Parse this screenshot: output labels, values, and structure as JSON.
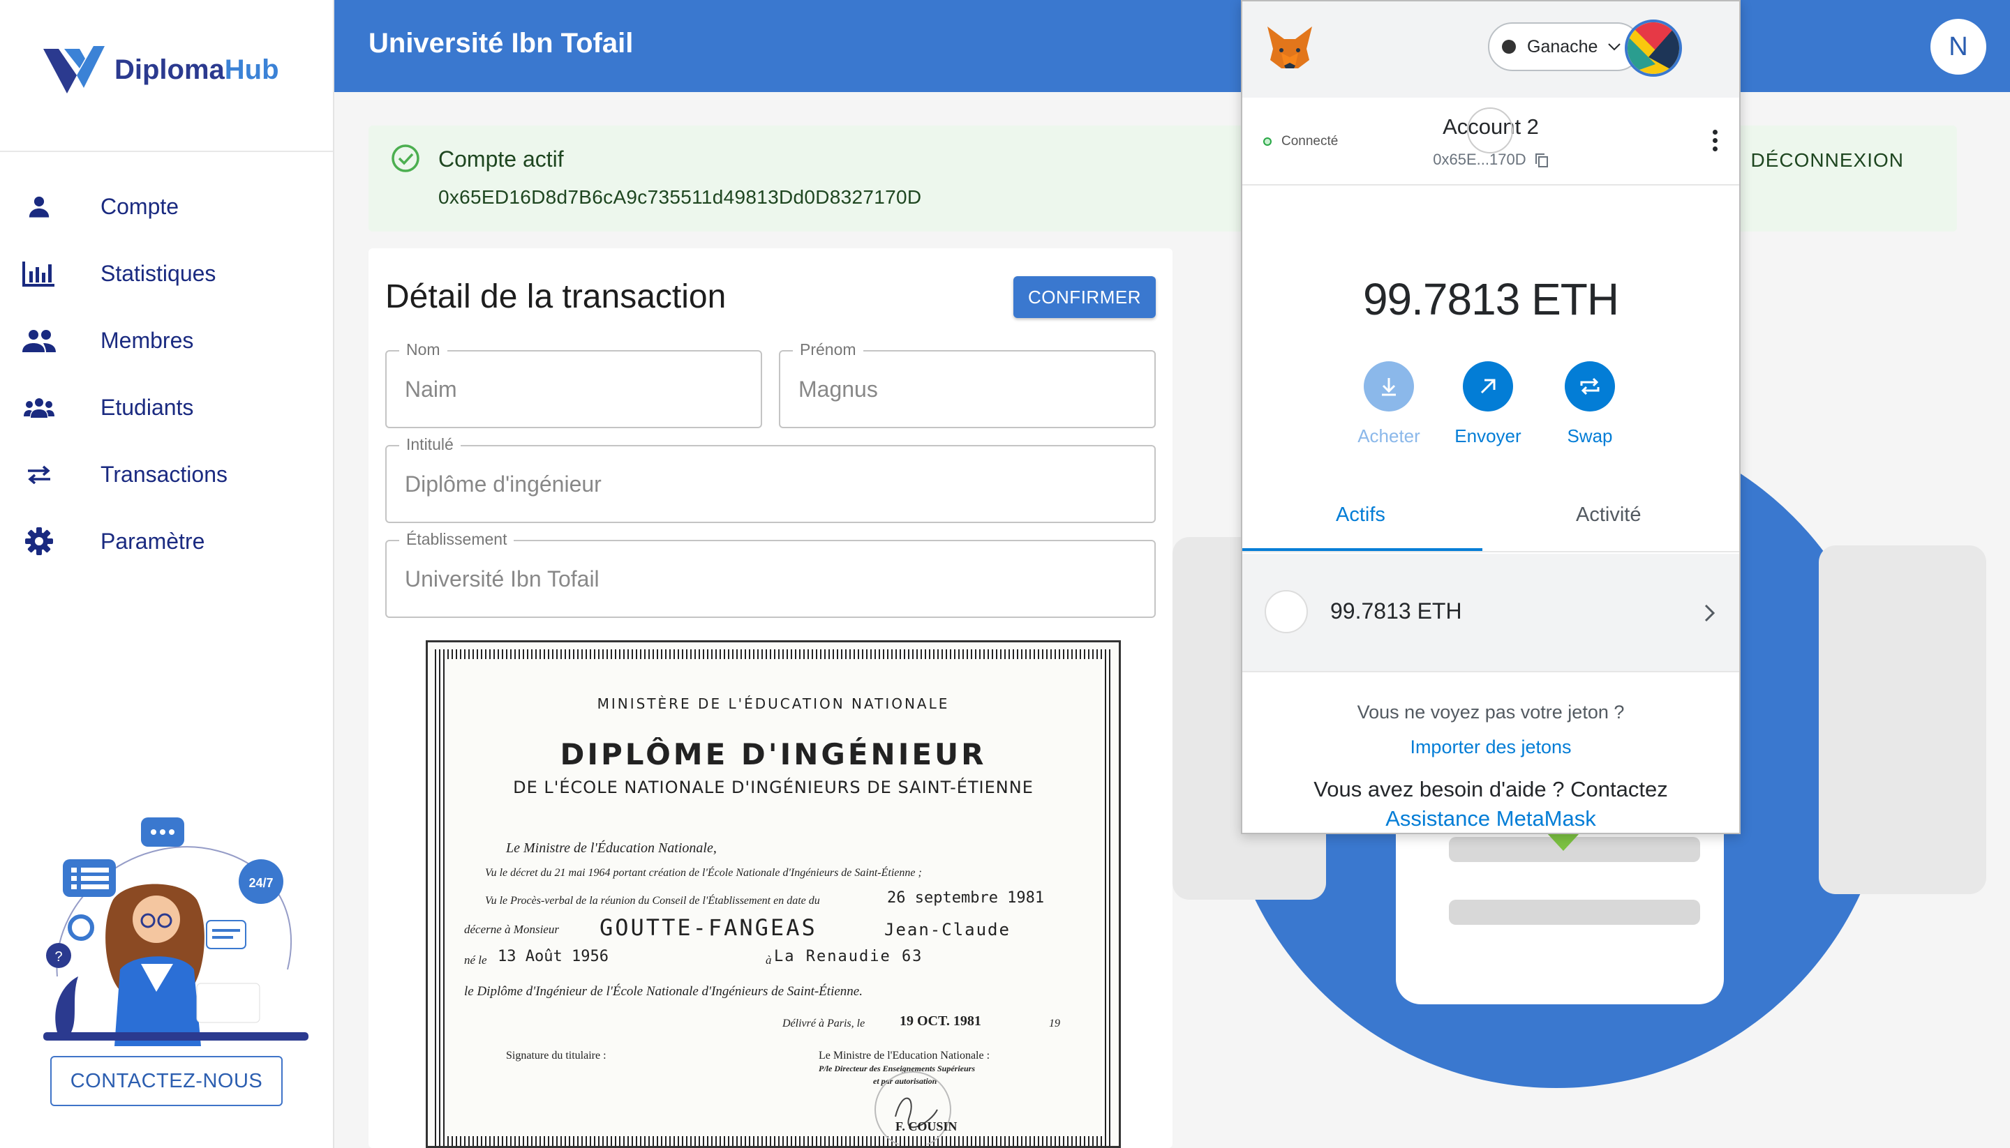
{
  "app": {
    "name_part1": "Diploma",
    "name_part2": "Hub"
  },
  "sidebar": {
    "items": [
      {
        "label": "Compte",
        "icon": "person-icon"
      },
      {
        "label": "Statistiques",
        "icon": "bar-chart-icon"
      },
      {
        "label": "Membres",
        "icon": "group-icon"
      },
      {
        "label": "Etudiants",
        "icon": "students-icon"
      },
      {
        "label": "Transactions",
        "icon": "swap-arrows-icon"
      },
      {
        "label": "Paramètre",
        "icon": "gear-icon"
      }
    ],
    "contact_label": "CONTACTEZ-NOUS",
    "support_badge": "24/7"
  },
  "header": {
    "university": "Université Ibn Tofail",
    "avatar_letter": "N"
  },
  "alert": {
    "title": "Compte actif",
    "address": "0x65ED16D8d7B6cA9c735511d49813Dd0D8327170D",
    "logout_label": "DÉCONNEXION"
  },
  "transaction": {
    "title": "Détail de la transaction",
    "confirm_label": "CONFIRMER",
    "fields": {
      "nom": {
        "label": "Nom",
        "value": "Naim"
      },
      "prenom": {
        "label": "Prénom",
        "value": "Magnus"
      },
      "intitule": {
        "label": "Intitulé",
        "value": "Diplôme d'ingénieur"
      },
      "etablissement": {
        "label": "Établissement",
        "value": "Université Ibn Tofail"
      }
    }
  },
  "diploma": {
    "ministry": "MINISTÈRE DE L'ÉDUCATION NATIONALE",
    "title": "DIPLÔME D'INGÉNIEUR",
    "subtitle": "DE L'ÉCOLE NATIONALE D'INGÉNIEURS DE SAINT-ÉTIENNE",
    "line1": "Le Ministre de l'Éducation Nationale,",
    "line2": "Vu le décret du 21 mai 1964 portant création de l'École Nationale d'Ingénieurs de Saint-Étienne ;",
    "line3a": "Vu le Procès-verbal de la réunion du Conseil de l'Établissement en date du",
    "line3b": "26 septembre 1981",
    "line4a": "décerne à Monsieur",
    "line4b": "GOUTTE-FANGEAS",
    "line4c": "Jean-Claude",
    "line5a": "né le",
    "line5b": "13 Août 1956",
    "line5c": "à",
    "line5d": "La Renaudie 63",
    "line6": "le Diplôme d'Ingénieur de l'École Nationale d'Ingénieurs de Saint-Étienne.",
    "delivered": "Délivré à Paris, le",
    "delivered_date": "19 OCT. 1981",
    "delivered_suffix": "19",
    "sig_holder": "Signature du titulaire :",
    "sig_minister1": "Le Ministre de l'Education Nationale :",
    "sig_minister2": "P/le Directeur des Enseignements Supérieurs",
    "sig_minister3": "et par autorisation",
    "sig_name": "F. COUSIN"
  },
  "metamask": {
    "network": "Ganache",
    "connected": "Connecté",
    "account_name": "Account 2",
    "account_addr": "0x65E...170D",
    "balance": "99.7813 ETH",
    "actions": {
      "buy": "Acheter",
      "send": "Envoyer",
      "swap": "Swap"
    },
    "tabs": {
      "assets": "Actifs",
      "activity": "Activité"
    },
    "asset_value": "99.7813 ETH",
    "help_q": "Vous ne voyez pas votre jeton ?",
    "import_link": "Importer des jetons",
    "help_contact": "Vous avez besoin d'aide ? Contactez",
    "assist_link": "Assistance MetaMask"
  },
  "colors": {
    "brand": "#3a78cf",
    "nav_text": "#1a2a80",
    "mm_blue": "#037dd6"
  }
}
